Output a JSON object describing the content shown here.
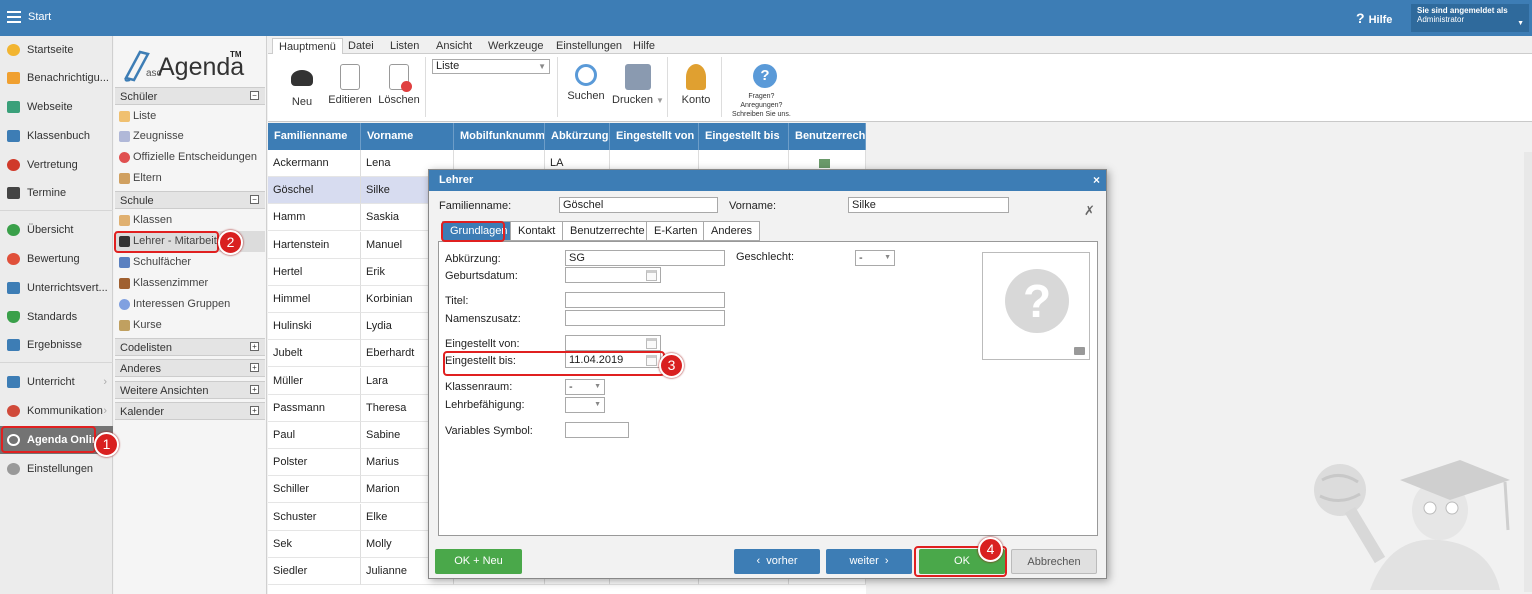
{
  "topbar": {
    "start": "Start",
    "help": "Hilfe",
    "login_line1": "Sie sind angemeldet als",
    "login_line2": "Administrator"
  },
  "leftnav": {
    "items": [
      "Startseite",
      "Benachrichtigu...",
      "Webseite",
      "Klassenbuch",
      "Vertretung",
      "Termine",
      "Übersicht",
      "Bewertung",
      "Unterrichtsvert...",
      "Standards",
      "Ergebnisse",
      "Unterricht",
      "Kommunikation",
      "Agenda Online",
      "Einstellungen"
    ]
  },
  "logo": {
    "asc": "asc",
    "name": "Agenda",
    "tm": "TM"
  },
  "sidebar": {
    "schueler": "Schüler",
    "schueler_items": [
      "Liste",
      "Zeugnisse",
      "Offizielle Entscheidungen",
      "Eltern"
    ],
    "schule": "Schule",
    "schule_items": [
      "Klassen",
      "Lehrer - Mitarbeiter",
      "Schulfächer",
      "Klassenzimmer",
      "Interessen Gruppen",
      "Kurse"
    ],
    "codelisten": "Codelisten",
    "anderes": "Anderes",
    "weitere": "Weitere Ansichten",
    "kalender": "Kalender"
  },
  "ribbon": {
    "tabs": [
      "Hauptmenü",
      "Datei",
      "Listen",
      "Ansicht",
      "Werkzeuge",
      "Einstellungen",
      "Hilfe"
    ],
    "neu": "Neu",
    "editieren": "Editieren",
    "loeschen": "Löschen",
    "list_select": "Liste",
    "suchen": "Suchen",
    "drucken": "Drucken",
    "konto": "Konto",
    "fragen1": "Fragen?",
    "fragen2": "Anregungen?",
    "fragen3": "Schreiben Sie uns."
  },
  "grid": {
    "headers": [
      "Familienname",
      "Vorname",
      "Mobilfunknummer",
      "Abkürzung",
      "Eingestellt von",
      "Eingestellt bis",
      "Benutzerrechte"
    ],
    "rows": [
      [
        "Ackermann",
        "Lena",
        "LA"
      ],
      [
        "Göschel",
        "Silke",
        ""
      ],
      [
        "Hamm",
        "Saskia",
        ""
      ],
      [
        "Hartenstein",
        "Manuel",
        ""
      ],
      [
        "Hertel",
        "Erik",
        ""
      ],
      [
        "Himmel",
        "Korbinian",
        ""
      ],
      [
        "Hulinski",
        "Lydia",
        ""
      ],
      [
        "Jubelt",
        "Eberhardt",
        ""
      ],
      [
        "Müller",
        "Lara",
        ""
      ],
      [
        "Passmann",
        "Theresa",
        ""
      ],
      [
        "Paul",
        "Sabine",
        ""
      ],
      [
        "Polster",
        "Marius",
        ""
      ],
      [
        "Schiller",
        "Marion",
        ""
      ],
      [
        "Schuster",
        "Elke",
        ""
      ],
      [
        "Sek",
        "Molly",
        ""
      ],
      [
        "Siedler",
        "Julianne",
        ""
      ]
    ]
  },
  "dialog": {
    "title": "Lehrer",
    "close": "×",
    "familienname_label": "Familienname:",
    "familienname": "Göschel",
    "vorname_label": "Vorname:",
    "vorname": "Silke",
    "tabs": [
      "Grundlagen",
      "Kontakt",
      "Benutzerrechte",
      "E-Karten",
      "Anderes"
    ],
    "abk_label": "Abkürzung:",
    "abk": "SG",
    "geschlecht_label": "Geschlecht:",
    "geschlecht": "-",
    "geburt_label": "Geburtsdatum:",
    "geburt": "",
    "titel_label": "Titel:",
    "titel": "",
    "namenszusatz_label": "Namenszusatz:",
    "namenszusatz": "",
    "von_label": "Eingestellt von:",
    "von": "",
    "bis_label": "Eingestellt bis:",
    "bis": "11.04.2019",
    "raum_label": "Klassenraum:",
    "raum": "-",
    "lehrbef_label": "Lehrbefähigung:",
    "lehrbef": "",
    "varsym_label": "Variables Symbol:",
    "varsym": "",
    "photo_placeholder": "?",
    "btn_oknew": "OK + Neu",
    "btn_prev": "vorher",
    "btn_next": "weiter",
    "btn_ok": "OK",
    "btn_cancel": "Abbrechen"
  },
  "badges": [
    "1",
    "2",
    "3",
    "4"
  ],
  "colors": {
    "primary": "#3d7db5",
    "ok": "#4aa84a",
    "highlight": "#e02020"
  }
}
